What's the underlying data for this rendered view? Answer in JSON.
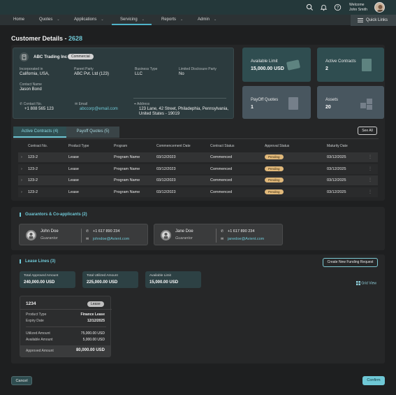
{
  "nav": {
    "items": [
      "Home",
      "Quotes",
      "Applications",
      "Servicing",
      "Reports",
      "Admin"
    ],
    "active": "Servicing",
    "quick_links": "Quick Links"
  },
  "user": {
    "welcome": "Welcome",
    "name": "John Smith"
  },
  "page": {
    "title": "Customer Details - ",
    "id": "2628"
  },
  "company": {
    "name": "ABC Trading Inc",
    "badge": "Commercial",
    "incorporated_label": "Incorporated in",
    "incorporated_value": "California, USA,",
    "parent_label": "Parent Party",
    "parent_value": "ABC Pvt. Ltd (123)",
    "business_label": "Business Type",
    "business_value": "LLC",
    "disclosure_label": "Limited Disclosure Party",
    "disclosure_value": "No",
    "contact_label": "Contact Name",
    "contact_value": "Jason Bond",
    "phone_label": "Contact No.",
    "phone_value": "+1 808 565 123",
    "email_label": "Email",
    "email_value": "abccorp@email.com",
    "address_label": "Address",
    "address_line1": "123 Lane, 42 Street, Philadephia, Pennsylvania,",
    "address_line2": "United States - 19019"
  },
  "kpis": {
    "available_limit": {
      "label": "Available Limit",
      "value": "15,000.00 USD"
    },
    "active_contracts": {
      "label": "Active Contracts",
      "value": "2"
    },
    "payoff_quotes": {
      "label": "PayOff Quotes",
      "value": "1"
    },
    "assets": {
      "label": "Assets",
      "value": "20"
    }
  },
  "tabs": {
    "active_contracts": "Active Contracts (4)",
    "payoff_quotes": "Payoff Quotes (5)",
    "see_all": "See All"
  },
  "table": {
    "headers": [
      "Contract No.",
      "Product Type",
      "Program",
      "Commencement Date",
      "Contract Status",
      "Approval Status",
      "Maturity Date"
    ],
    "rows": [
      [
        "123-2",
        "Lease",
        "Program Name",
        "03/12/2023",
        "Commenced",
        "Pending",
        "03/12/2025"
      ],
      [
        "123-2",
        "Lease",
        "Program Name",
        "03/12/2023",
        "Commenced",
        "Pending",
        "03/12/2025"
      ],
      [
        "123-2",
        "Lease",
        "Program Name",
        "03/12/2023",
        "Commenced",
        "Pending",
        "03/12/2025"
      ],
      [
        "123-2",
        "Lease",
        "Program Name",
        "03/12/2023",
        "Commenced",
        "Pending",
        "03/12/2025"
      ]
    ]
  },
  "guarantors": {
    "title": "Guarantors & Co-applicants (2)",
    "list": [
      {
        "name": "John Doe",
        "role": "Guarantor",
        "phone": "+1 617 890 234",
        "email": "johndoe@Avient.com"
      },
      {
        "name": "Jane Doe",
        "role": "Guarantor",
        "phone": "+1 617 890 234",
        "email": "janedoe@Avient.com"
      }
    ]
  },
  "lease_lines": {
    "title": "Lease Lines (3)",
    "new_request": "Create New Funding Request",
    "grid_view": "Grid View",
    "summary": [
      {
        "label": "Total Approved Amount",
        "value": "240,000.00 USD"
      },
      {
        "label": "Total Utilized Amount",
        "value": "225,000.00 USD"
      },
      {
        "label": "Available Limit",
        "value": "15,000.00 USD"
      }
    ],
    "card": {
      "id": "1234",
      "badge": "Lease",
      "product_type_label": "Product Type",
      "product_type_value": "Finance Lease",
      "expiry_label": "Expiry Date",
      "expiry_value": "12/12/2025",
      "utilized_label": "Utilized Amount",
      "utilized_value": "75,000.00 USD",
      "available_label": "Available Amount",
      "available_value": "5,000.00 USD",
      "approved_label": "Approved Amount",
      "approved_value": "80,000.00 USD"
    }
  },
  "footer": {
    "cancel": "Cancel",
    "confirm": "Confirm"
  },
  "icons": [
    "search-icon",
    "bell-icon",
    "help-icon",
    "grid-icon",
    "building-icon",
    "phone-icon",
    "email-icon",
    "location-icon",
    "card-icon",
    "document-icon",
    "boxes-icon",
    "chevron-right-icon",
    "user-icon"
  ],
  "colors": {
    "accent": "#6fc8d6",
    "pending": "#e0b87a"
  }
}
